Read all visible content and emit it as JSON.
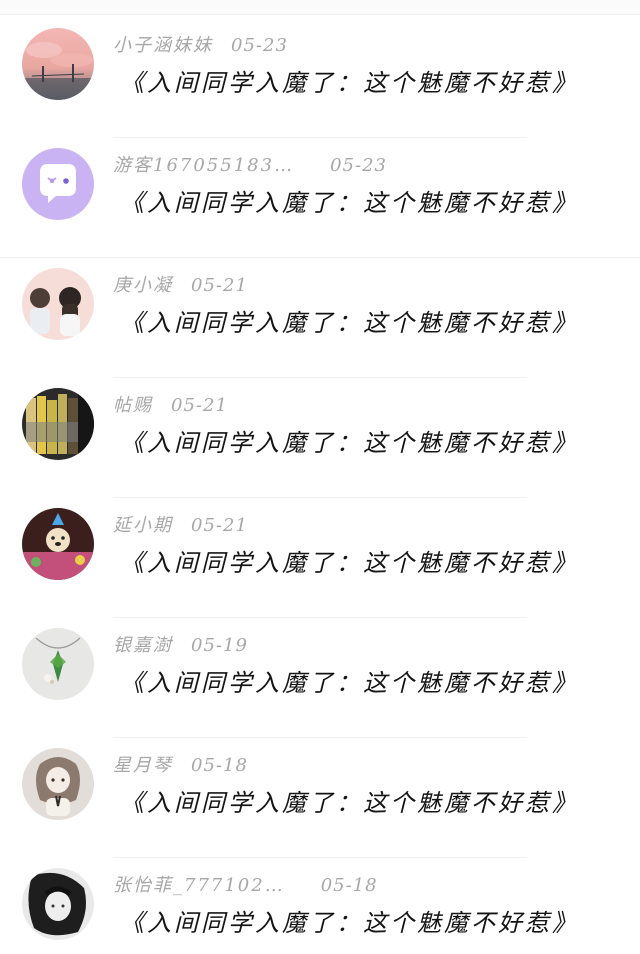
{
  "comments": [
    {
      "username": "小子涵妹妹",
      "date": "05-23",
      "text": "《入间同学入魔了：这个魅魔不好惹》",
      "avatar_icon": "sunset-sky-avatar-icon"
    },
    {
      "username": "游客167055183…",
      "date": "05-23",
      "text": "《入间同学入魔了：这个魅魔不好惹》",
      "avatar_icon": "chat-bubble-avatar-icon"
    },
    {
      "username": "庚小凝",
      "date": "05-21",
      "text": "《入间同学入魔了：这个魅魔不好惹》",
      "avatar_icon": "couple-avatar-icon"
    },
    {
      "username": "帖赐",
      "date": "05-21",
      "text": "《入间同学入魔了：这个魅魔不好惹》",
      "avatar_icon": "books-avatar-icon"
    },
    {
      "username": "延小期",
      "date": "05-21",
      "text": "《入间同学入魔了：这个魅魔不好惹》",
      "avatar_icon": "dog-party-avatar-icon"
    },
    {
      "username": "银嘉澍",
      "date": "05-19",
      "text": "《入间同学入魔了：这个魅魔不好惹》",
      "avatar_icon": "necklace-avatar-icon"
    },
    {
      "username": "星月琴",
      "date": "05-18",
      "text": "《入间同学入魔了：这个魅魔不好惹》",
      "avatar_icon": "anime-girl-avatar-icon"
    },
    {
      "username": "张怡菲_777102…",
      "date": "05-18",
      "text": "《入间同学入魔了：这个魅魔不好惹》",
      "avatar_icon": "portrait-bw-avatar-icon"
    }
  ]
}
